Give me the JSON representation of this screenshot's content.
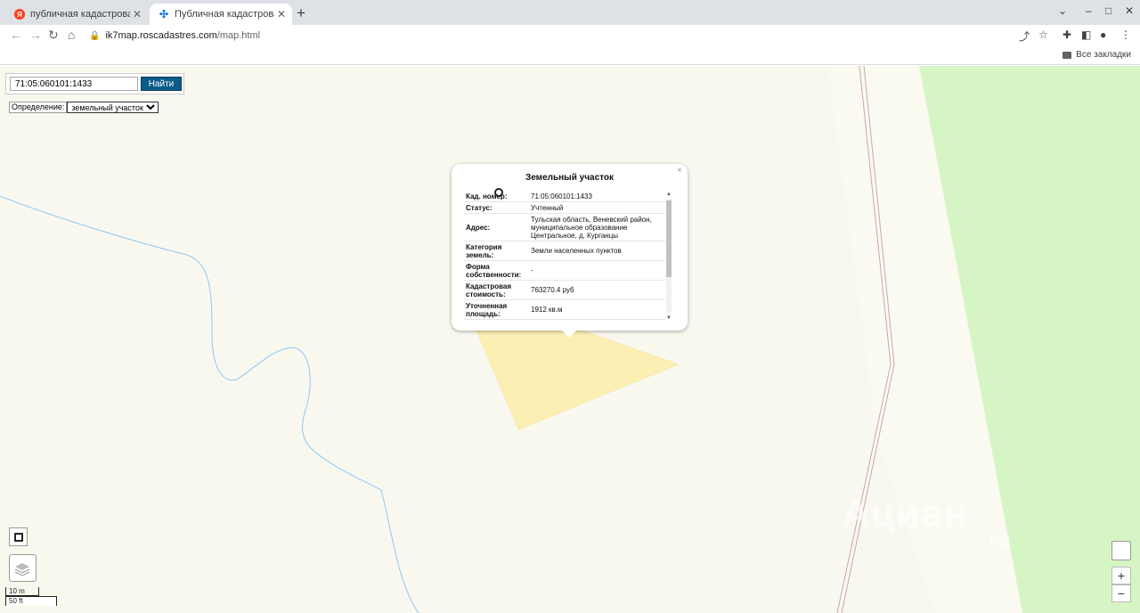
{
  "browser": {
    "tabs": [
      {
        "title": "публичная кадастровая ка",
        "icon": "yandex-icon"
      },
      {
        "title": "Публичная кадастровая ка",
        "icon": "roscadastres-icon"
      }
    ],
    "url_host": "ik7map.roscadastres.com",
    "url_path": "/map.html",
    "bookmarks_label": "Все закладки"
  },
  "search": {
    "value": "71:05:060101:1433",
    "button_label": "Найти"
  },
  "definition": {
    "label": "Определение:",
    "selected": "земельный участок"
  },
  "popup": {
    "title": "Земельный участок",
    "close": "×",
    "rows": [
      {
        "key": "Кад. номер:",
        "value": "71:05:060101:1433"
      },
      {
        "key": "Статус:",
        "value": "Учтенный"
      },
      {
        "key": "Адрес:",
        "value": "Тульская область, Веневский район, муниципальное образование Центральное, д. Курганцы"
      },
      {
        "key": "Категория земель:",
        "value": "Земли населенных пунктов"
      },
      {
        "key": "Форма собственности:",
        "value": "-"
      },
      {
        "key": "Кадастровая стоимость:",
        "value": "763270.4 руб"
      },
      {
        "key": "Уточненная площадь:",
        "value": "1912 кв.м"
      }
    ]
  },
  "scale": {
    "metric": "10 m",
    "imperial": "50 ft"
  },
  "zoom": {
    "in": "+",
    "out": "−"
  },
  "watermark": {
    "text": "Ациан",
    "number": "58"
  },
  "colors": {
    "map_bg": "#f9f8ef",
    "parcel_fill": "#fcefb3",
    "forest": "#d6f5c4",
    "river": "#8cc8f0",
    "search_button": "#0b5c88"
  }
}
